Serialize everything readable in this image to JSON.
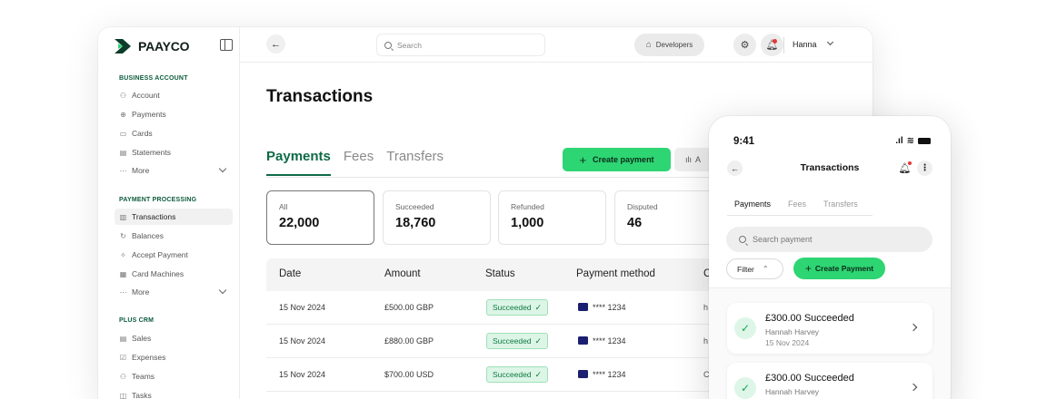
{
  "brand": {
    "name": "PAAYCO",
    "accent": "#2ed573",
    "brand_green": "#0f6a47"
  },
  "sidebar": {
    "sections": [
      {
        "title": "BUSINESS ACCOUNT",
        "items": [
          {
            "label": "Account",
            "icon": "account-icon"
          },
          {
            "label": "Payments",
            "icon": "globe-icon"
          },
          {
            "label": "Cards",
            "icon": "card-icon"
          },
          {
            "label": "Statements",
            "icon": "document-icon"
          },
          {
            "label": "More",
            "icon": "more-icon"
          }
        ]
      },
      {
        "title": "PAYMENT PROCESSING",
        "items": [
          {
            "label": "Transactions",
            "icon": "transactions-icon",
            "active": true
          },
          {
            "label": "Balances",
            "icon": "balances-icon"
          },
          {
            "label": "Accept Payment",
            "icon": "accept-payment-icon"
          },
          {
            "label": "Card Machines",
            "icon": "card-machine-icon"
          },
          {
            "label": "More",
            "icon": "more-icon"
          }
        ]
      },
      {
        "title": "PLUS CRM",
        "items": [
          {
            "label": "Sales",
            "icon": "sales-icon"
          },
          {
            "label": "Expenses",
            "icon": "expenses-icon"
          },
          {
            "label": "Teams",
            "icon": "teams-icon"
          },
          {
            "label": "Tasks",
            "icon": "tasks-icon"
          }
        ]
      }
    ]
  },
  "topbar": {
    "search_placeholder": "Search",
    "developers_label": "Developers",
    "user_name": "Hanna"
  },
  "main": {
    "title": "Transactions",
    "tabs": [
      "Payments",
      "Fees",
      "Transfers"
    ],
    "create_label": "Create payment",
    "analytics_label": "A",
    "stats": [
      {
        "label": "All",
        "value": "22,000",
        "active": true
      },
      {
        "label": "Succeeded",
        "value": "18,760"
      },
      {
        "label": "Refunded",
        "value": "1,000"
      },
      {
        "label": "Disputed",
        "value": "46"
      }
    ],
    "table": {
      "columns": [
        "Date",
        "Amount",
        "Status",
        "Payment method",
        "C"
      ],
      "rows": [
        {
          "date": "15 Nov 2024",
          "amount": "£500.00 GBP",
          "status": "Succeeded",
          "card": "**** 1234",
          "extra": "h"
        },
        {
          "date": "15 Nov 2024",
          "amount": "£880.00 GBP",
          "status": "Succeeded",
          "card": "**** 1234",
          "extra": "h"
        },
        {
          "date": "15 Nov 2024",
          "amount": "$700.00 USD",
          "status": "Succeeded",
          "card": "**** 1234",
          "extra": "C"
        }
      ]
    }
  },
  "phone": {
    "time": "9:41",
    "title": "Transactions",
    "tabs": [
      "Payments",
      "Fees",
      "Transfers"
    ],
    "search_placeholder": "Search payment",
    "filter_label": "Filter",
    "create_label": "Create Payment",
    "items": [
      {
        "amount": "£300.00 Succeeded",
        "name": "Hannah Harvey",
        "date": "15 Nov 2024"
      },
      {
        "amount": "£300.00 Succeeded",
        "name": "Hannah Harvey",
        "date": ""
      }
    ]
  }
}
